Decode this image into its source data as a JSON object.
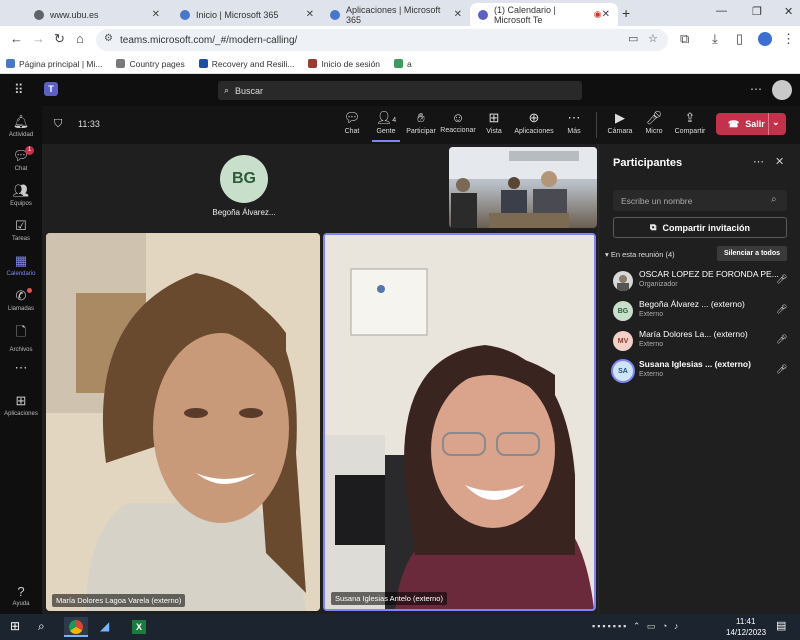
{
  "browser": {
    "tabs": [
      {
        "title": "www.ubu.es",
        "color": "#5f6368"
      },
      {
        "title": "Inicio | Microsoft 365",
        "color": "#4a76c9"
      },
      {
        "title": "Aplicaciones | Microsoft 365",
        "color": "#4a76c9"
      },
      {
        "title": "(1) Calendario | Microsoft Te",
        "color": "#5b5fc7"
      }
    ],
    "url": "teams.microsoft.com/_#/modern-calling/",
    "bookmarks": [
      "Página principal | Mi...",
      "Country pages",
      "Recovery and Resili...",
      "Inicio de sesión",
      "a"
    ]
  },
  "teams": {
    "search_placeholder": "Buscar",
    "rail": [
      {
        "label": "Actividad",
        "icon": "bell-icon"
      },
      {
        "label": "Chat",
        "icon": "chat-icon",
        "badge": "1"
      },
      {
        "label": "Equipos",
        "icon": "teams-icon"
      },
      {
        "label": "Tareas",
        "icon": "tasks-icon"
      },
      {
        "label": "Calendario",
        "icon": "calendar-icon"
      },
      {
        "label": "Llamadas",
        "icon": "phone-icon"
      },
      {
        "label": "Archivos",
        "icon": "files-icon"
      },
      {
        "label": "",
        "icon": "more-icon"
      },
      {
        "label": "Aplicaciones",
        "icon": "apps-icon"
      },
      {
        "label": "Ayuda",
        "icon": "help-icon"
      }
    ],
    "meeting": {
      "timer": "11:33",
      "toolbar": [
        {
          "label": "Chat",
          "icon": "chat-icon"
        },
        {
          "label": "Gente",
          "icon": "people-icon",
          "count": "4"
        },
        {
          "label": "Participar",
          "icon": "raise-hand-icon"
        },
        {
          "label": "Reaccionar",
          "icon": "react-icon"
        },
        {
          "label": "Vista",
          "icon": "view-icon"
        },
        {
          "label": "Aplicaciones",
          "icon": "apps-icon"
        },
        {
          "label": "Más",
          "icon": "more-icon"
        },
        {
          "label": "Cámara",
          "icon": "camera-icon"
        },
        {
          "label": "Micro",
          "icon": "mic-icon"
        },
        {
          "label": "Compartir",
          "icon": "share-icon"
        }
      ],
      "leave_label": "Salir",
      "avatar_initials": "BG",
      "avatar_name": "Begoña Álvarez...",
      "tiles": [
        {
          "label": "María Dolores Lagoa Varela (externo)"
        },
        {
          "label": "Susana Iglesias Antelo (externo)"
        }
      ]
    },
    "participants": {
      "title": "Participantes",
      "search_placeholder": "Escribe un nombre",
      "share_label": "Compartir invitación",
      "section_label": "En esta reunión (4)",
      "mute_all_label": "Silenciar a todos",
      "list": [
        {
          "initials": "",
          "name": "OSCAR LOPEZ DE FORONDA PE...",
          "role": "Organizador",
          "color": "#d8d8d8",
          "text": "#333"
        },
        {
          "initials": "BG",
          "name": "Begoña Álvarez ... (externo)",
          "role": "Externo",
          "color": "#c8dfcc",
          "text": "#2c5b37"
        },
        {
          "initials": "MV",
          "name": "María Dolores La... (externo)",
          "role": "Externo",
          "color": "#f3d1c9",
          "text": "#8a3b2b"
        },
        {
          "initials": "SA",
          "name": "Susana Iglesias ... (externo)",
          "role": "Externo",
          "color": "#cfe4f5",
          "text": "#1f4f7a"
        }
      ]
    }
  },
  "taskbar": {
    "time": "11:41",
    "date": "14/12/2023"
  }
}
